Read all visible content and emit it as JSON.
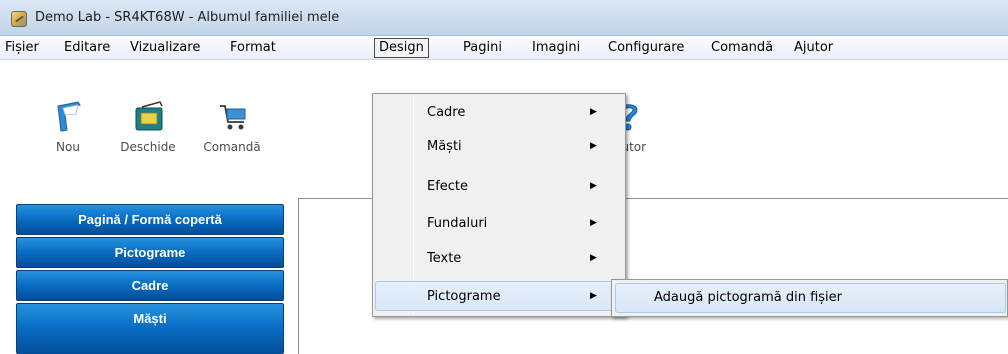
{
  "window": {
    "title": "Demo Lab - SR4KT68W - Albumul familiei mele",
    "icon": "demo-lab-app-icon"
  },
  "menubar": {
    "items": [
      "Fișier",
      "Editare",
      "Vizualizare",
      "Format",
      "Design",
      "Pagini",
      "Imagini",
      "Configurare",
      "Comandă",
      "Ajutor"
    ],
    "active": "Design"
  },
  "toolbar": {
    "tools": [
      {
        "label": "Nou",
        "icon": "new-document-icon"
      },
      {
        "label": "Deschide",
        "icon": "open-album-icon"
      },
      {
        "label": "Comandă",
        "icon": "shopping-cart-icon"
      },
      {
        "label": "Ajutor",
        "icon": "help-question-icon"
      }
    ]
  },
  "nav": {
    "buttons": [
      "Pagină / Formă copertă",
      "Pictograme",
      "Cadre",
      "Măști"
    ],
    "color": "#0a6fc6"
  },
  "design_menu": {
    "items": [
      {
        "label": "Cadre",
        "submenu": true
      },
      {
        "label": "Măști",
        "submenu": true
      },
      {
        "label": "Efecte",
        "submenu": true
      },
      {
        "label": "Fundaluri",
        "submenu": true
      },
      {
        "label": "Texte",
        "submenu": true
      },
      {
        "label": "Pictograme",
        "submenu": true
      }
    ],
    "highlighted": "Pictograme"
  },
  "pictograme_submenu": {
    "items": [
      "Adaugă pictogramă din fișier"
    ]
  }
}
